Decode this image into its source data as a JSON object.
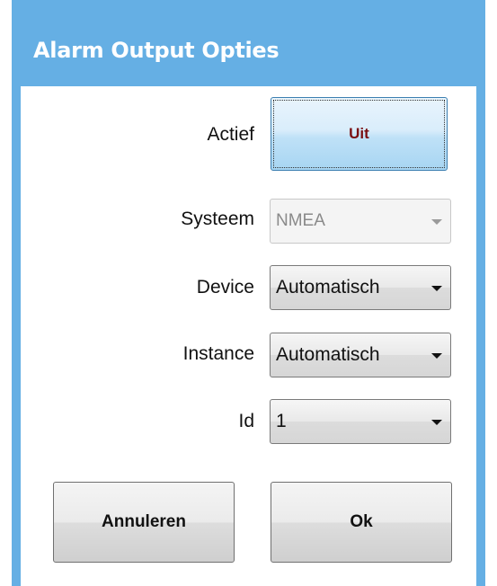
{
  "dialog": {
    "title": "Alarm Output Opties"
  },
  "form": {
    "actief": {
      "label": "Actief",
      "value": "Uit"
    },
    "systeem": {
      "label": "Systeem",
      "value": "NMEA",
      "disabled": true
    },
    "device": {
      "label": "Device",
      "value": "Automatisch"
    },
    "instance": {
      "label": "Instance",
      "value": "Automatisch"
    },
    "id": {
      "label": "Id",
      "value": "1"
    }
  },
  "buttons": {
    "cancel_label": "Annuleren",
    "ok_label": "Ok"
  },
  "colors": {
    "title_bar": "#65afe4",
    "toggle_text": "#7a0f12"
  }
}
